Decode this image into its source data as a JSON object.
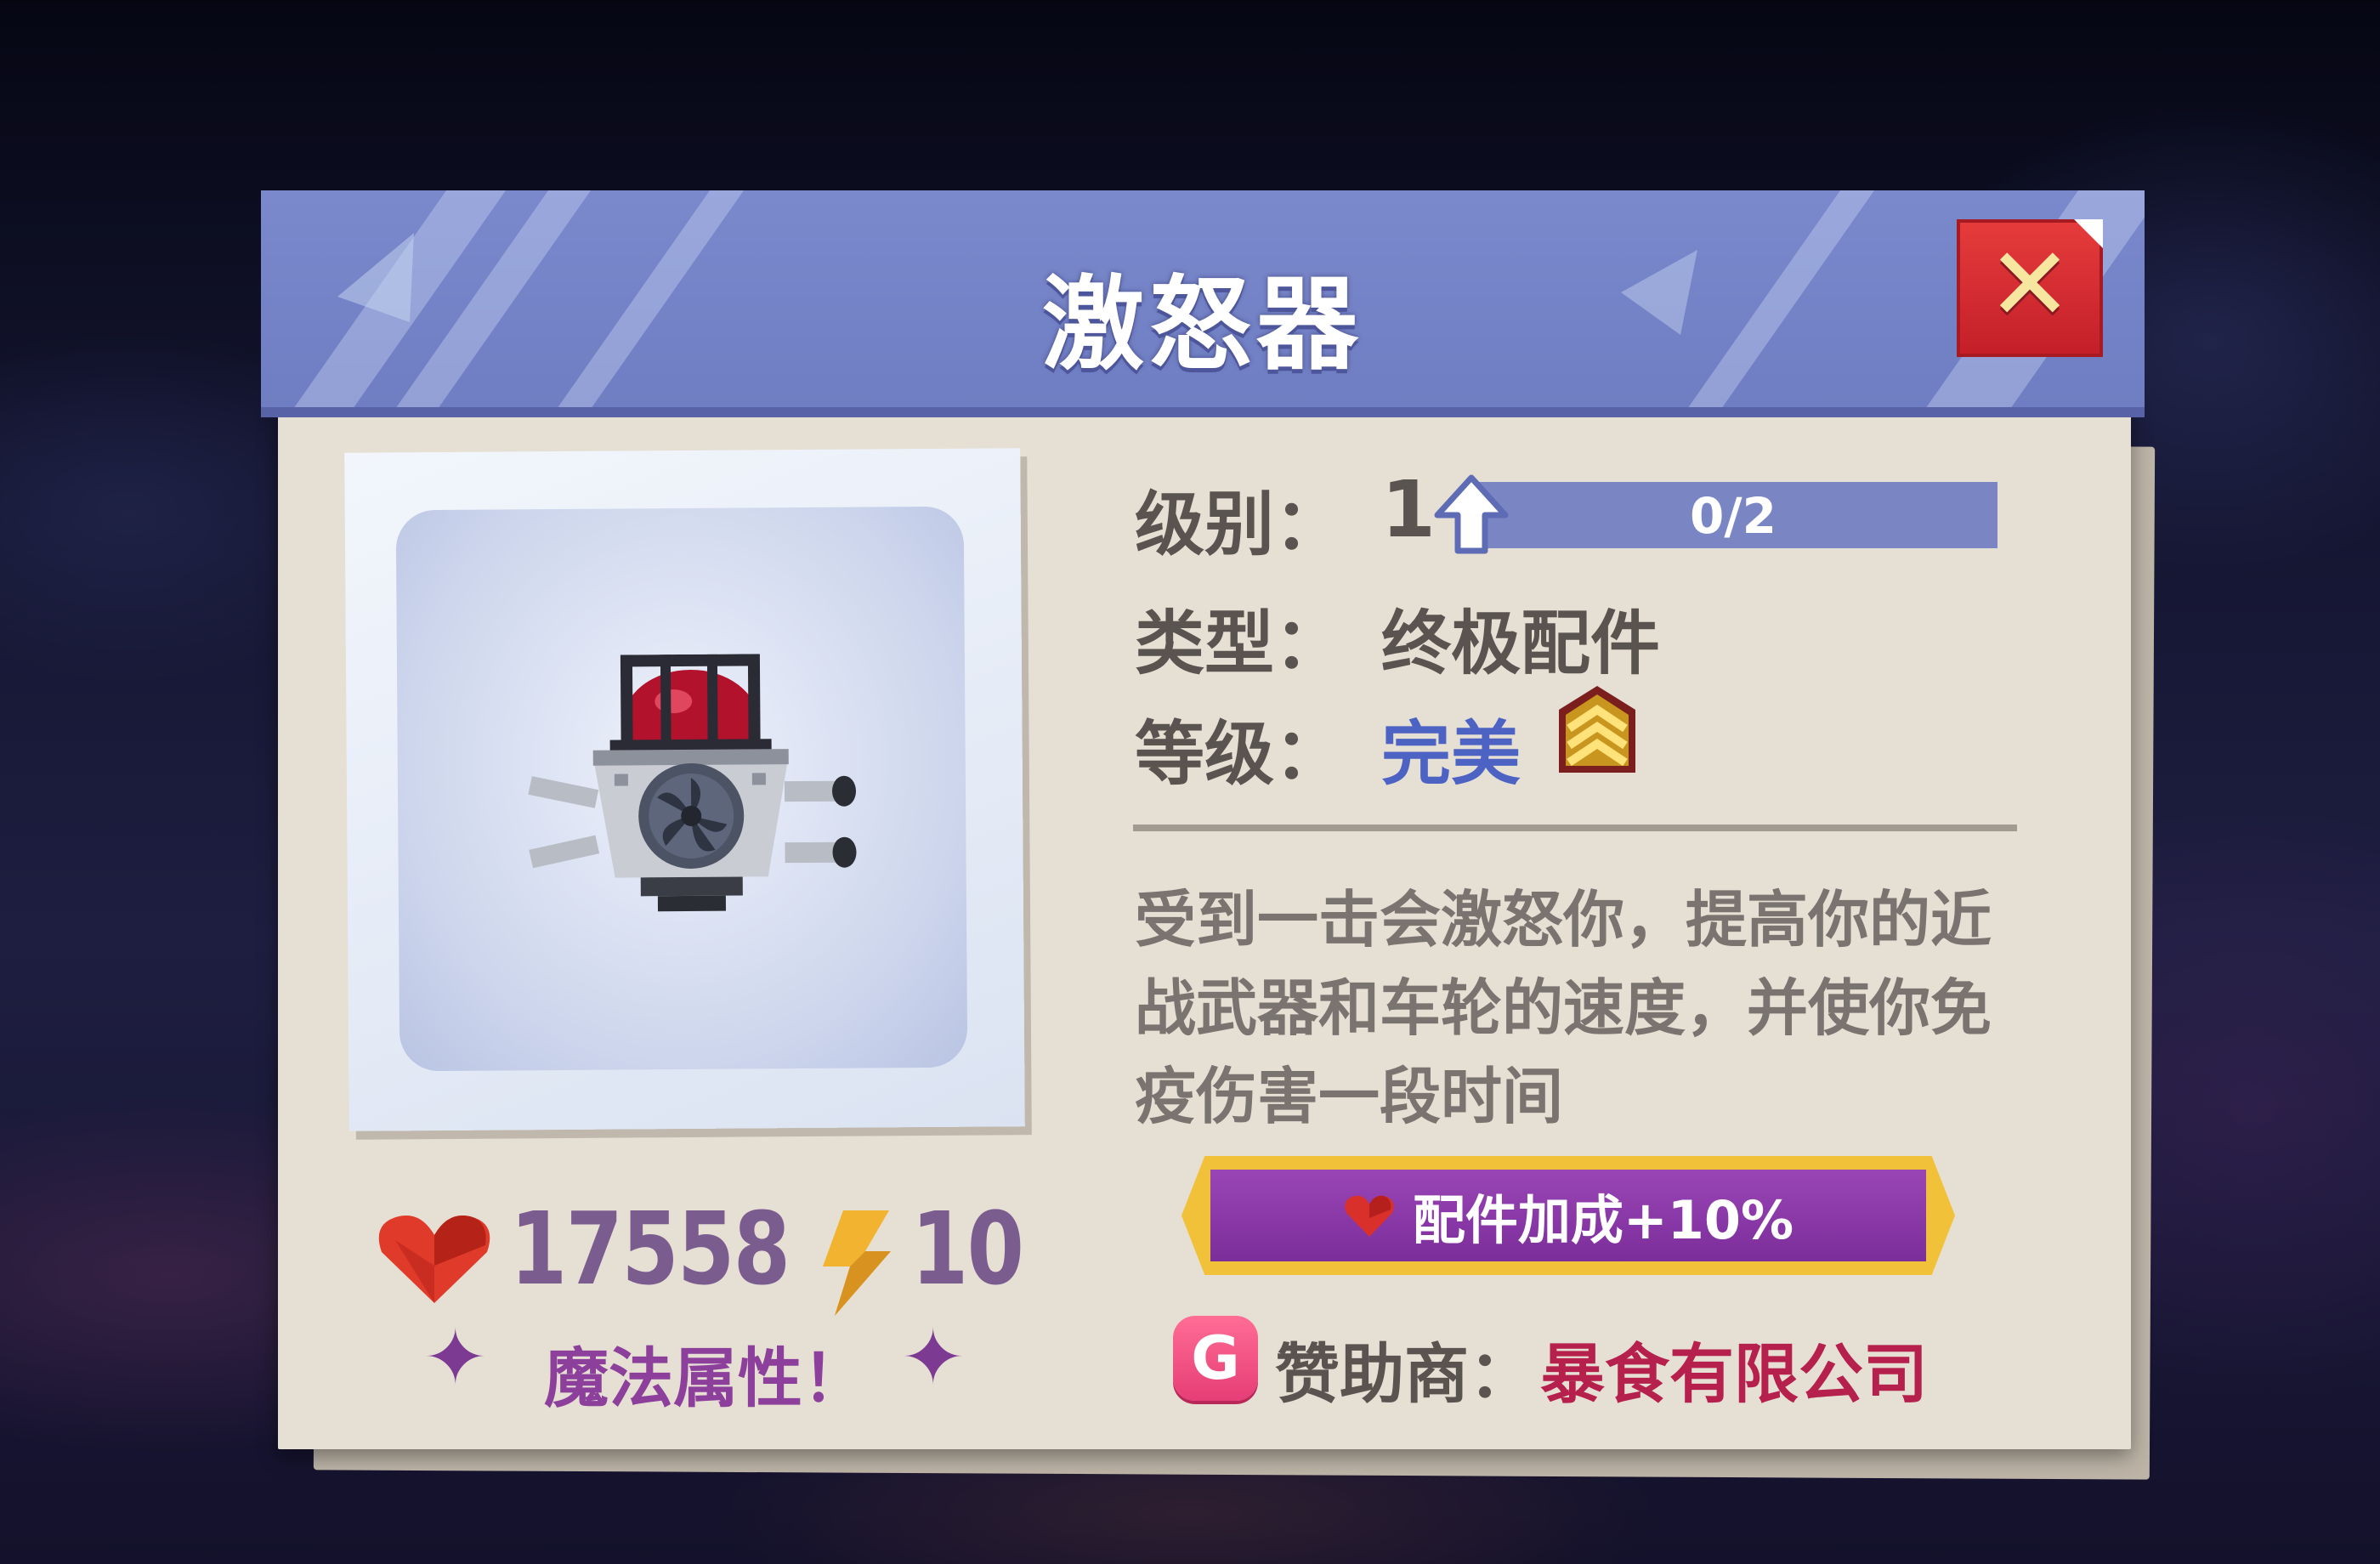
{
  "dialog": {
    "title": "激怒器",
    "close_icon": "close-icon"
  },
  "item": {
    "image_icon": "enrager-device-icon",
    "level_label": "级别：",
    "level_value": "1",
    "level_progress_text": "0/2",
    "level_progress_fraction": 0.0,
    "upgrade_icon": "upgrade-arrow-icon",
    "type_label": "类型：",
    "type_value": "终极配件",
    "grade_label": "等级：",
    "grade_value": "完美",
    "grade_icon": "rank-chevron-icon",
    "description": "受到一击会激怒你，提高你的近战武器和车轮的速度，并使你免疫伤害一段时间"
  },
  "stats": {
    "health_icon": "heart-icon",
    "health_value": "17558",
    "energy_icon": "lightning-icon",
    "energy_value": "10",
    "magic_text": "魔法属性！"
  },
  "bonus": {
    "icon": "heart-icon",
    "text": "配件加成+10%"
  },
  "sponsor": {
    "label": "赞助商：",
    "name": "暴食有限公司",
    "icon": "sponsor-logo-icon"
  },
  "colors": {
    "header": "#7a89cc",
    "panel": "#e6dfd4",
    "close": "#d9303a",
    "grade": "#4d63c4",
    "bonus": "#8a3aa8",
    "sponsor_name": "#b5204d",
    "stat": "#7b5c8f"
  }
}
